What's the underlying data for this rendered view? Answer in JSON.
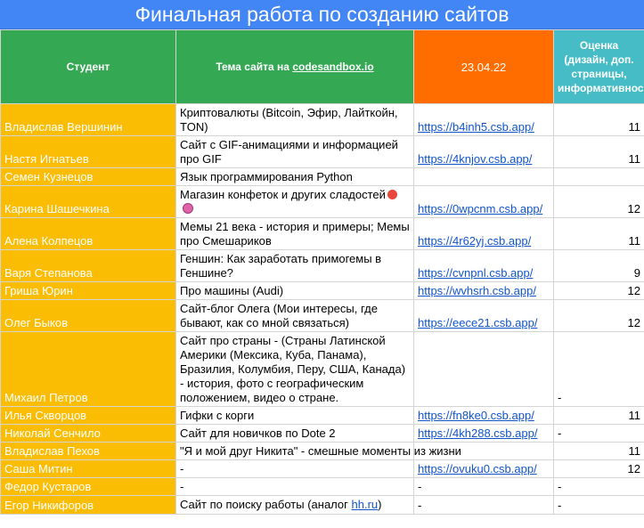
{
  "title": "Финальная работа по созданию сайтов",
  "headers": {
    "student": "Студент",
    "topic_prefix": "Тема сайта на ",
    "topic_link": "codesandbox.io",
    "date": "23.04.22",
    "grade": "Оценка (дизайн, доп. страницы, информативность)"
  },
  "rows": [
    {
      "name": "Владислав Вершинин",
      "topic": "Криптовалюты (Bitcoin, Эфир, Лайткойн, TON)",
      "link": "https://b4inh5.csb.app/",
      "grade": "11"
    },
    {
      "name": "Настя Игнатьев",
      "topic": "Сайт с GIF-анимациями и информацией про GIF",
      "link": "https://4knjov.csb.app/",
      "grade": "11"
    },
    {
      "name": "Семен Кузнецов",
      "topic": "Язык программирования Python",
      "link": "",
      "grade": ""
    },
    {
      "name": "Карина Шашечкина",
      "topic": "Магазин конфеток и других сладостей",
      "link": "https://0wpcnm.csb.app/",
      "grade": "12"
    },
    {
      "name": "Алена Колпецов",
      "topic": "Мемы 21 века - история и примеры; Мемы про Смешариков",
      "link": "https://4r62yj.csb.app/",
      "grade": "11"
    },
    {
      "name": "Варя Степанова",
      "topic": "Геншин: Как заработать примогемы в Геншине?",
      "link": "https://cvnpnl.csb.app/",
      "grade": "9"
    },
    {
      "name": "Гриша Юрин",
      "topic": "Про машины (Audi)",
      "link": "https://wvhsrh.csb.app/",
      "grade": "12"
    },
    {
      "name": "Олег Быков",
      "topic": "Сайт-блог Олега (Мои интересы, где бывают, как со мной связаться)",
      "link": "https://eece21.csb.app/",
      "grade": "12"
    },
    {
      "name": "Михаил Петров",
      "topic": "Сайт про страны - (Страны Латинской Америки (Мексика, Куба, Панама), Бразилия, Колумбия, Перу, США, Канада) - история, фото с географическим положением, видео о стране.",
      "link": "",
      "grade": "-"
    },
    {
      "name": "Илья Скворцов",
      "topic": "Гифки с корги",
      "link": "https://fn8ke0.csb.app/",
      "grade": "11"
    },
    {
      "name": "Николай Сенчило",
      "topic": "Сайт для новичков по Dote 2",
      "link": "https://4kh288.csb.app/",
      "grade": "-"
    },
    {
      "name": "Владислав Пехов",
      "topic": "\"Я и мой друг Никита\" - смешные моменты из жизни",
      "link": "",
      "grade": "11"
    },
    {
      "name": "Саша Митин",
      "topic": "-",
      "link": "https://ovuku0.csb.app/",
      "grade": "12"
    },
    {
      "name": "Федор Кустаров",
      "topic": "-",
      "link": "-",
      "grade": "-"
    },
    {
      "name": "Егор Никифоров",
      "topic_prefix": "Сайт по поиску работы (аналог ",
      "topic_link": "hh.ru",
      "topic_suffix": ")",
      "link": "-",
      "grade": "-"
    }
  ],
  "colors": {
    "title": "#4285f4",
    "student_header": "#34a853",
    "topic_header": "#34a853",
    "date_header": "#ff6d01",
    "grade_header": "#46bdc6",
    "name_cells": "#fbbc04",
    "link": "#1155cc"
  }
}
